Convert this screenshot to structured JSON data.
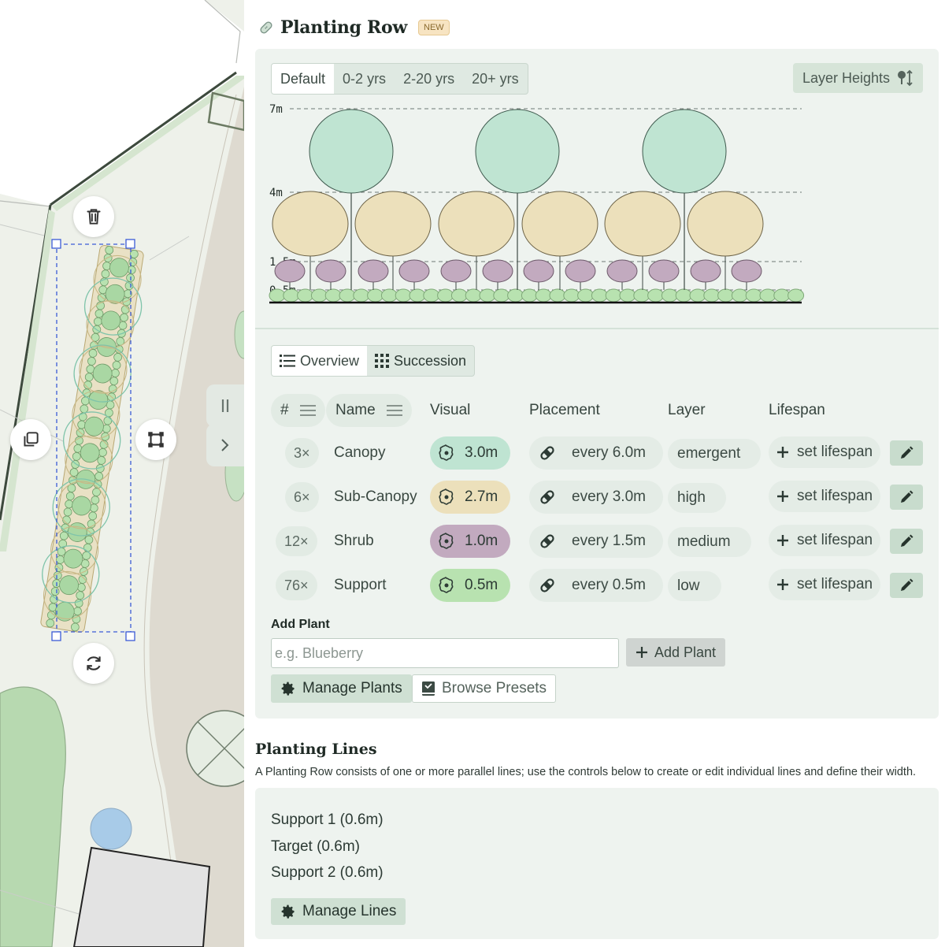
{
  "header": {
    "title": "Planting Row",
    "badge": "NEW"
  },
  "age_tabs": [
    "Default",
    "0-2 yrs",
    "2-20 yrs",
    "20+ yrs"
  ],
  "layer_heights_label": "Layer Heights",
  "diagram": {
    "height_labels": [
      "7m",
      "4m",
      "1.5m",
      "0.5m"
    ],
    "colors": {
      "canopy": "#bfe4d2",
      "subcanopy": "#ece0bb",
      "shrub": "#c2aabf",
      "support": "#b8e2b0"
    }
  },
  "view_tabs": {
    "overview": "Overview",
    "succession": "Succession"
  },
  "table": {
    "headers": {
      "count": "#",
      "name": "Name",
      "visual": "Visual",
      "placement": "Placement",
      "layer": "Layer",
      "lifespan": "Lifespan"
    },
    "rows": [
      {
        "count": "3×",
        "name": "Canopy",
        "visual": "3.0m",
        "color": "#bfe4d2",
        "placement": "every 6.0m",
        "layer": "emergent",
        "lifespan": "set lifespan"
      },
      {
        "count": "6×",
        "name": "Sub-Canopy",
        "visual": "2.7m",
        "color": "#ece0bb",
        "placement": "every 3.0m",
        "layer": "high",
        "lifespan": "set lifespan"
      },
      {
        "count": "12×",
        "name": "Shrub",
        "visual": "1.0m",
        "color": "#c2aabf",
        "placement": "every 1.5m",
        "layer": "medium",
        "lifespan": "set lifespan"
      },
      {
        "count": "76×",
        "name": "Support",
        "visual": "0.5m",
        "color": "#b8e2b0",
        "placement": "every 0.5m",
        "layer": "low",
        "lifespan": "set lifespan"
      }
    ]
  },
  "add_plant": {
    "label": "Add Plant",
    "placeholder": "e.g. Blueberry",
    "button": "Add Plant"
  },
  "buttons": {
    "manage_plants": "Manage Plants",
    "browse_presets": "Browse Presets",
    "manage_lines": "Manage Lines"
  },
  "planting_lines": {
    "title": "Planting Lines",
    "description": "A Planting Row consists of one or more parallel lines; use the controls below to create or edit individual lines and define their width.",
    "lines": [
      "Support 1 (0.6m)",
      "Target (0.6m)",
      "Support 2 (0.6m)"
    ]
  }
}
